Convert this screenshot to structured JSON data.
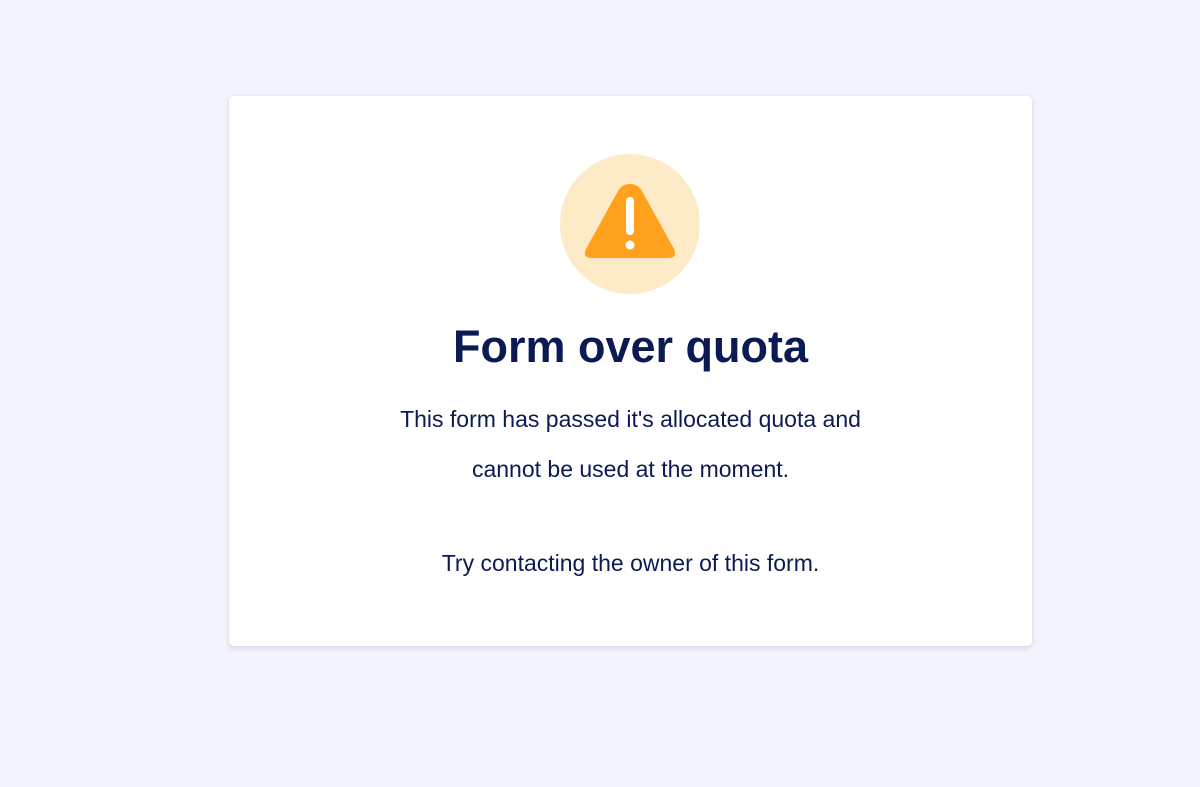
{
  "page": {
    "background_color": "#f3f3fd"
  },
  "card": {
    "icon": "warning-triangle-icon",
    "icon_color": "#ffa11c",
    "icon_bg_color": "#fdebc8",
    "title": "Form over quota",
    "message_line_1": "This form has passed it's allocated quota and",
    "message_line_2": "cannot be used at the moment.",
    "hint": "Try contacting the owner of this form.",
    "text_color": "#0c1a54"
  }
}
